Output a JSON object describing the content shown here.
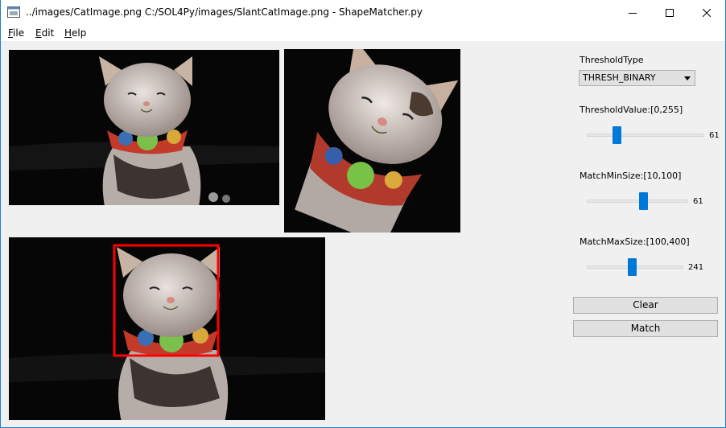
{
  "window": {
    "title": "../images/CatImage.png C:/SOL4Py/images/SlantCatImage.png - ShapeMatcher.py"
  },
  "menu": {
    "file": {
      "key": "F",
      "rest": "ile"
    },
    "edit": {
      "key": "E",
      "rest": "dit"
    },
    "help": {
      "key": "H",
      "rest": "elp"
    }
  },
  "controls": {
    "threshold_type": {
      "label": "ThresholdType",
      "selected": "THRESH_BINARY"
    },
    "threshold_value": {
      "label": "ThresholdValue:[0,255]",
      "value": "61",
      "fraction": 0.24
    },
    "match_min_size": {
      "label": "MatchMinSize:[10,100]",
      "value": "61",
      "fraction": 0.567
    },
    "match_max_size": {
      "label": "MatchMaxSize:[100,400]",
      "value": "241",
      "fraction": 0.47
    },
    "clear_label": "Clear",
    "match_label": "Match"
  },
  "colors": {
    "accent": "#0078d7",
    "match_box": "#ff0000",
    "image_bg": "#060606"
  }
}
